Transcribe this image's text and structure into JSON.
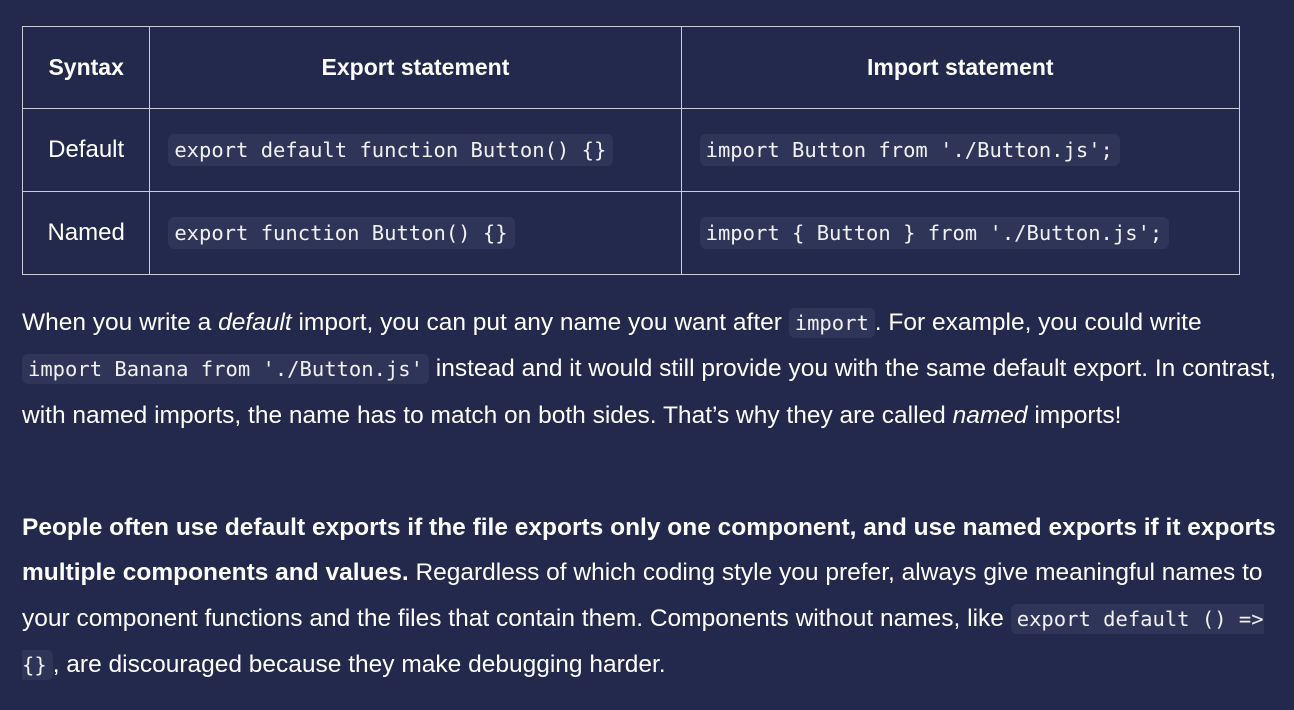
{
  "table": {
    "headers": {
      "syntax": "Syntax",
      "export": "Export statement",
      "import": "Import statement"
    },
    "rows": [
      {
        "syntax": "Default",
        "export_code": "export default function Button() {}",
        "import_code": "import Button from './Button.js';"
      },
      {
        "syntax": "Named",
        "export_code": "export function Button() {}",
        "import_code": "import { Button } from './Button.js';"
      }
    ]
  },
  "paragraph1": {
    "t1": "When you write a ",
    "em1": "default",
    "t2": " import, you can put any name you want after ",
    "code1": "import",
    "t3": ". For example, you could write ",
    "code2": "import Banana from './Button.js'",
    "t4": " instead and it would still provide you with the same default export. In contrast, with named imports, the name has to match on both sides. That’s why they are called ",
    "em2": "named",
    "t5": " imports!"
  },
  "paragraph2": {
    "strong": "People often use default exports if the file exports only one component, and use named exports if it exports multiple components and values.",
    "t1": " Regardless of which coding style you prefer, always give meaningful names to your component functions and the files that contain them. Components without names, like ",
    "code1": "export default () => {}",
    "t2": ", are discouraged because they make debugging harder."
  }
}
